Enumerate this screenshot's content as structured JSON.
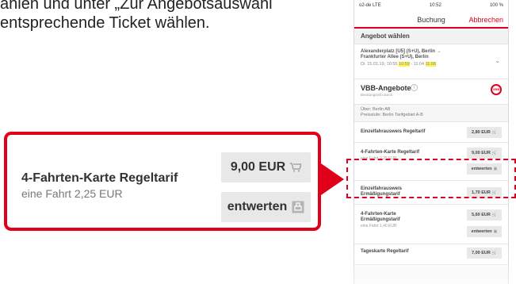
{
  "caption": {
    "line1": "ählen und unter „Zur Angebotsauswahl",
    "line2": "entsprechende Ticket wählen."
  },
  "zoom": {
    "ticket_name": "4-Fahrten-Karte Regeltarif",
    "ticket_sub": "eine Fahrt 2,25 EUR",
    "price_label": "9,00 EUR",
    "cart_icon": "cart-icon",
    "cancel_label": "entwerten",
    "stamp_icon": "stamp-icon"
  },
  "phone": {
    "status": {
      "carrier": "o2-de  LTE",
      "time": "10:52",
      "battery": "100 %"
    },
    "nav": {
      "title": "Buchung",
      "cancel": "Abbrechen"
    },
    "section_offer": "Angebot wählen",
    "route": {
      "line1": "Alexanderplatz [U5] (S+U), Berlin →",
      "line2": "Frankfurter Allee (S+U), Berlin",
      "line3_pre": "Di. 15.01.19, 10:55 ",
      "line3_hl1": "10:59",
      "line3_mid": " - 11:04 ",
      "line3_hl2": "11:08"
    },
    "vbb": {
      "title": "VBB-Angebote",
      "sub": "Beratungsinfo durch",
      "logo": "VBB"
    },
    "info_lines": {
      "l1": "Über: Berlin AB",
      "l2": "Preisstufe: Berlin Tarifgebiet A-B"
    },
    "rows": [
      {
        "name": "Einzelfahrausweis Regeltarif",
        "sub": "",
        "price": "2,80 EUR"
      },
      {
        "name": "4-Fahrten-Karte Regeltarif",
        "sub": "eine Fahrt 2,25 EUR",
        "price": "9,00 EUR",
        "cancel": "entwerten"
      },
      {
        "name": "Einzelfahrausweis Ermäßigungstarif",
        "sub": "",
        "price": "1,70 EUR"
      },
      {
        "name": "4-Fahrten-Karte Ermäßigungstarif",
        "sub": "eine Fahrt 1,40 EUR",
        "price": "5,60 EUR",
        "cancel": "entwerten"
      },
      {
        "name": "Tageskarte Regeltarif",
        "sub": "",
        "price": "7,00 EUR"
      }
    ]
  },
  "colors": {
    "accent": "#e1001a",
    "button_bg": "#e8e8e8"
  }
}
